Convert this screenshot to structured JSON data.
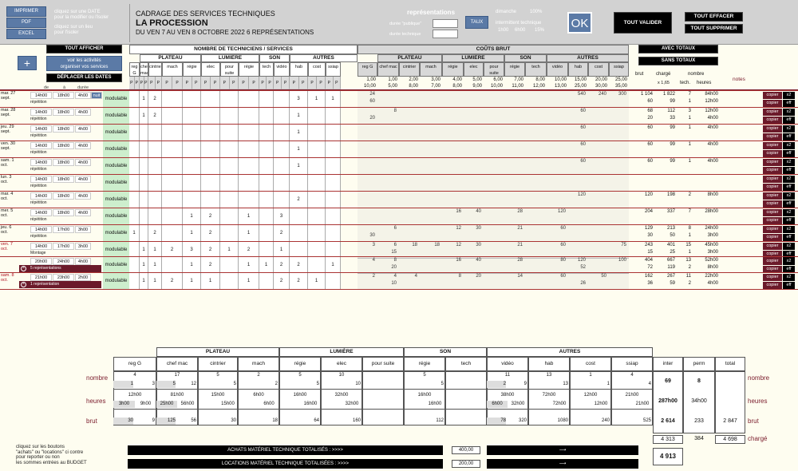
{
  "header": {
    "imprimer": "IMPRIMER",
    "pdf": "PDF",
    "excel": "EXCEL",
    "hint1a": "cliquez sur une DATE",
    "hint1b": "pour la modifier ou l'isoler",
    "hint2a": "cliquez sur un lieu",
    "hint2b": "pour l'isoler",
    "doc_title": "CADRAGE DES SERVICES TECHNIQUES",
    "show": "LA PROCESSION",
    "dates": "DU VEN 7 AU VEN 8 OCTOBRE 2022 6 REPRÉSENTATIONS",
    "representations": "représentations",
    "duree_public": "durée \"publique\"",
    "duree_technique": "durée technique",
    "taux": "TAUX",
    "dimanche": "dimanche",
    "dimanche_pct": "100%",
    "intermittent": "intermittent technique",
    "int1": "1h00",
    "int2": "6h00",
    "int3": "15%",
    "ok": "OK",
    "tout_valider": "TOUT VALIDER",
    "tout_effacer": "TOUT EFFACER",
    "tout_supprimer": "TOUT SUPPRIMER"
  },
  "toolbar": {
    "plus": "+",
    "tout_afficher": "TOUT AFFICHER",
    "voir1": "voir les activités",
    "voir2": "organiser vos services",
    "deplacer": "DÉPLACER LES DATES",
    "de": "de",
    "a": "à",
    "duree": "durée"
  },
  "sections": {
    "nombre": "NOMBRE DE TECHNICIENS / SERVICES",
    "couts": "COÛTS BRUT",
    "avec_totaux": "AVEC TOTAUX",
    "sans_totaux": "SANS TOTAUX",
    "brut": "brut",
    "charge": "chargé",
    "x165": "x 1,65",
    "nombre_tech": "nombre",
    "tech": "tech.",
    "heures": "heures",
    "notes": "notes"
  },
  "groups": {
    "plateau": "PLATEAU",
    "lumiere": "LUMIÈRE",
    "son": "SON",
    "autres": "AUTRES"
  },
  "cols": [
    "reg G",
    "chef mac",
    "cintrier",
    "mach",
    "régie",
    "elec",
    "pour suite",
    "régie",
    "tech",
    "vidéo",
    "hab",
    "cost",
    "ssiap"
  ],
  "rates": [
    [
      "1,00",
      "10,00"
    ],
    [
      "1,00",
      "5,00"
    ],
    [
      "2,00",
      "8,00"
    ],
    [
      "3,00",
      "7,00"
    ],
    [
      "4,00",
      "8,00"
    ],
    [
      "5,00",
      "9,00"
    ],
    [
      "6,00",
      "10,00"
    ],
    [
      "7,00",
      "11,00"
    ],
    [
      "8,00",
      "12,00"
    ],
    [
      "10,00",
      "13,00"
    ],
    [
      "15,00",
      "25,00"
    ],
    [
      "20,00",
      "30,00"
    ],
    [
      "25,00",
      "35,00"
    ]
  ],
  "rows": [
    {
      "d": "mar. 27",
      "m": "sept.",
      "t1": "14h00",
      "t2": "18h00",
      "t3": "4h00",
      "tag": "nuit",
      "sub": "répétition",
      "mod": "modulable",
      "counts": [
        "",
        "1",
        "2",
        "",
        "",
        "",
        "",
        "",
        "",
        "",
        "3",
        "1",
        "1"
      ],
      "c1": [
        "24",
        "",
        "",
        "",
        "",
        "",
        "",
        "",
        "",
        "",
        "540",
        "240",
        "300"
      ],
      "c2": [
        "60"
      ],
      "b": "1 104",
      "ch": "1 822",
      "n": "7",
      "h": "84h00",
      "b2": "60",
      "ch2": "99",
      "n2": "1",
      "h2": "12h00"
    },
    {
      "d": "mar. 28",
      "m": "sept.",
      "t1": "14h00",
      "t2": "18h00",
      "t3": "4h00",
      "sub": "répétition",
      "mod": "modulable",
      "counts": [
        "",
        "1",
        "2",
        "",
        "",
        "",
        "",
        "",
        "",
        "",
        "1",
        "",
        ""
      ],
      "c1": [
        "",
        "8",
        "",
        "",
        "",
        "",
        "",
        "",
        "",
        "",
        "60",
        "",
        ""
      ],
      "c2": [
        "20"
      ],
      "b": "68",
      "ch": "112",
      "n": "3",
      "h": "12h00",
      "b2": "20",
      "ch2": "33",
      "n2": "1",
      "h2": "4h00"
    },
    {
      "d": "jeu. 29",
      "m": "sept.",
      "t1": "14h00",
      "t2": "18h00",
      "t3": "4h00",
      "sub": "répétition",
      "mod": "modulable",
      "counts": [
        "",
        "",
        "",
        "",
        "",
        "",
        "",
        "",
        "",
        "",
        "1",
        "",
        ""
      ],
      "c1": [
        "",
        "",
        "",
        "",
        "",
        "",
        "",
        "",
        "",
        "",
        "60",
        "",
        ""
      ],
      "c2": [
        ""
      ],
      "b": "60",
      "ch": "99",
      "n": "1",
      "h": "4h00",
      "b2": "",
      "ch2": "",
      "n2": "",
      "h2": ""
    },
    {
      "d": "ven. 30",
      "m": "sept.",
      "t1": "14h00",
      "t2": "18h00",
      "t3": "4h00",
      "sub": "répétition",
      "mod": "modulable",
      "counts": [
        "",
        "",
        "",
        "",
        "",
        "",
        "",
        "",
        "",
        "",
        "1",
        "",
        ""
      ],
      "c1": [
        "",
        "",
        "",
        "",
        "",
        "",
        "",
        "",
        "",
        "",
        "60",
        "",
        ""
      ],
      "c2": [
        ""
      ],
      "b": "60",
      "ch": "99",
      "n": "1",
      "h": "4h00",
      "b2": "",
      "ch2": "",
      "n2": "",
      "h2": ""
    },
    {
      "d": "sam. 1",
      "m": "oct.",
      "t1": "14h00",
      "t2": "18h00",
      "t3": "4h00",
      "sub": "répétition",
      "mod": "modulable",
      "counts": [
        "",
        "",
        "",
        "",
        "",
        "",
        "",
        "",
        "",
        "",
        "1",
        "",
        ""
      ],
      "c1": [
        "",
        "",
        "",
        "",
        "",
        "",
        "",
        "",
        "",
        "",
        "60",
        "",
        ""
      ],
      "c2": [
        ""
      ],
      "b": "60",
      "ch": "99",
      "n": "1",
      "h": "4h00",
      "b2": "",
      "ch2": "",
      "n2": "",
      "h2": ""
    },
    {
      "d": "lun. 3",
      "m": "oct.",
      "t1": "14h00",
      "t2": "18h00",
      "t3": "4h00",
      "sub": "répétition",
      "mod": "modulable",
      "counts": [
        "",
        "",
        "",
        "",
        "",
        "",
        "",
        "",
        "",
        "",
        "",
        "",
        ""
      ],
      "c1": [
        "",
        "",
        "",
        "",
        "",
        "",
        "",
        "",
        "",
        "",
        "",
        "",
        ""
      ],
      "c2": [
        ""
      ],
      "b": "",
      "ch": "",
      "n": "",
      "h": "",
      "b2": "",
      "ch2": "",
      "n2": "",
      "h2": ""
    },
    {
      "d": "mar. 4",
      "m": "oct.",
      "t1": "14h00",
      "t2": "18h00",
      "t3": "4h00",
      "sub": "répétition",
      "mod": "modulable",
      "counts": [
        "",
        "",
        "",
        "",
        "",
        "",
        "",
        "",
        "",
        "",
        "2",
        "",
        ""
      ],
      "c1": [
        "",
        "",
        "",
        "",
        "",
        "",
        "",
        "",
        "",
        "",
        "120",
        "",
        ""
      ],
      "c2": [
        ""
      ],
      "b": "120",
      "ch": "198",
      "n": "2",
      "h": "8h00",
      "b2": "",
      "ch2": "",
      "n2": "",
      "h2": ""
    },
    {
      "d": "mer. 5",
      "m": "oct.",
      "t1": "14h00",
      "t2": "18h00",
      "t3": "4h00",
      "sub": "répétition",
      "mod": "modulable",
      "counts": [
        "",
        "",
        "",
        "",
        "1",
        "2",
        "",
        "1",
        "",
        "3",
        "",
        "",
        ""
      ],
      "c1": [
        "",
        "",
        "",
        "",
        "16",
        "40",
        "",
        "28",
        "",
        "120",
        "",
        "",
        ""
      ],
      "c2": [
        ""
      ],
      "b": "204",
      "ch": "337",
      "n": "7",
      "h": "28h00",
      "b2": "",
      "ch2": "",
      "n2": "",
      "h2": ""
    },
    {
      "d": "jeu. 6",
      "m": "oct.",
      "t1": "14h00",
      "t2": "17h00",
      "t3": "3h00",
      "sub": "répétition",
      "mod": "modulable",
      "counts": [
        "1",
        "",
        "2",
        "",
        "1",
        "2",
        "",
        "1",
        "",
        "2",
        "",
        "",
        ""
      ],
      "c1": [
        "",
        "6",
        "",
        "",
        "12",
        "30",
        "",
        "21",
        "",
        "60",
        "",
        "",
        ""
      ],
      "c2": [
        "30"
      ],
      "b": "129",
      "ch": "213",
      "n": "8",
      "h": "24h00",
      "b2": "30",
      "ch2": "50",
      "n2": "1",
      "h2": "3h00"
    },
    {
      "d": "ven. 7",
      "m": "oct.",
      "red": true,
      "t1": "14h00",
      "t2": "17h00",
      "t3": "3h00",
      "sub": "Montage",
      "mod": "modulable",
      "counts": [
        "",
        "1",
        "1",
        "2",
        "3",
        "2",
        "1",
        "2",
        "",
        "1",
        "",
        "",
        ""
      ],
      "c1": [
        "3",
        "6",
        "18",
        "18",
        "12",
        "30",
        "",
        "21",
        "",
        "60",
        "",
        "",
        "75"
      ],
      "c2": [
        "",
        "15"
      ],
      "b": "243",
      "ch": "401",
      "n": "15",
      "h": "45h00",
      "b2": "15",
      "ch2": "25",
      "n2": "1",
      "h2": "3h00"
    },
    {
      "d": "",
      "m": "",
      "t1": "20h00",
      "t2": "24h00",
      "t3": "4h00",
      "sub": "5 représentations",
      "subdark": true,
      "mod": "modulable",
      "counts": [
        "",
        "1",
        "1",
        "",
        "1",
        "2",
        "",
        "1",
        "1",
        "2",
        "2",
        "",
        "1"
      ],
      "c1": [
        "4",
        "8",
        "",
        "",
        "16",
        "40",
        "",
        "28",
        "",
        "80",
        "120",
        "",
        "100"
      ],
      "c2": [
        "",
        "20",
        "",
        "",
        "",
        "",
        "",
        "",
        "",
        "",
        "52"
      ],
      "b": "404",
      "ch": "667",
      "n": "13",
      "h": "52h00",
      "b2": "72",
      "ch2": "119",
      "n2": "2",
      "h2": "8h00"
    },
    {
      "d": "sam. 8",
      "m": "oct.",
      "red": true,
      "t1": "21h00",
      "t2": "23h00",
      "t3": "2h00",
      "sub": "1 représentation",
      "subdark": true,
      "mod": "modulable",
      "counts": [
        "",
        "1",
        "1",
        "2",
        "1",
        "1",
        "",
        "1",
        "",
        "2",
        "2",
        "1",
        ""
      ],
      "c1": [
        "2",
        "4",
        "4",
        "",
        "8",
        "20",
        "",
        "14",
        "",
        "60",
        "",
        "50",
        ""
      ],
      "c2": [
        "",
        "10",
        "",
        "",
        "",
        "",
        "",
        "",
        "",
        "",
        "26"
      ],
      "b": "162",
      "ch": "267",
      "n": "11",
      "h": "22h00",
      "b2": "36",
      "ch2": "59",
      "n2": "2",
      "h2": "4h00"
    }
  ],
  "rowbtns": {
    "copier": "copier",
    "x2": "x2",
    "eff": "eff"
  },
  "summary": {
    "nombre": "nombre",
    "heures": "heures",
    "brut": "brut",
    "charge": "chargé",
    "groups": {
      "plateau": "PLATEAU",
      "lumiere": "LUMIÈRE",
      "son": "SON",
      "autres": "AUTRES"
    },
    "cols": [
      "reg G",
      "chef mac",
      "cintrier",
      "mach",
      "régie",
      "elec",
      "pour suite",
      "régie",
      "tech",
      "vidéo",
      "hab",
      "cost",
      "ssiap",
      "inter",
      "perm",
      "total"
    ],
    "nb_top": [
      "4",
      "17",
      "5",
      "2",
      "5",
      "10",
      "",
      "5",
      "",
      "11",
      "13",
      "1",
      "4"
    ],
    "nb_sub": [
      [
        "1",
        "3"
      ],
      [
        "5",
        "12"
      ],
      [
        "",
        "5"
      ],
      [
        "",
        "2"
      ],
      [
        "",
        "5"
      ],
      [
        "",
        "10"
      ],
      [
        "",
        ""
      ],
      [
        "",
        "5"
      ],
      [
        "",
        ""
      ],
      [
        "2",
        "9"
      ],
      [
        "",
        "13"
      ],
      [
        "",
        "1"
      ],
      [
        "",
        "4"
      ]
    ],
    "inter_nb": "69",
    "perm_nb": "8",
    "hr_top": [
      "12h00",
      "81h00",
      "15h00",
      "6h00",
      "16h00",
      "32h00",
      "",
      "16h00",
      "",
      "38h00",
      "72h00",
      "12h00",
      "21h00"
    ],
    "hr_sub": [
      [
        "3h00",
        "9h00"
      ],
      [
        "25h00",
        "56h00"
      ],
      [
        "",
        "15h00"
      ],
      [
        "",
        "6h00"
      ],
      [
        "",
        "16h00"
      ],
      [
        "",
        "32h00"
      ],
      [
        "",
        ""
      ],
      [
        "",
        "16h00"
      ],
      [
        "",
        ""
      ],
      [
        "6h00",
        "32h00"
      ],
      [
        "",
        "72h00"
      ],
      [
        "",
        "12h00"
      ],
      [
        "",
        "21h00"
      ]
    ],
    "inter_hr": "287h00",
    "perm_hr": "34h00",
    "br": [
      [
        "30",
        "9"
      ],
      [
        "125",
        "56"
      ],
      [
        "",
        "30"
      ],
      [
        "",
        "18"
      ],
      [
        "",
        "64"
      ],
      [
        "",
        "160"
      ],
      [
        "",
        ""
      ],
      [
        "",
        "112"
      ],
      [
        "",
        ""
      ],
      [
        "78",
        "320"
      ],
      [
        "",
        "1080"
      ],
      [
        "",
        "240"
      ],
      [
        "",
        "525"
      ]
    ],
    "inter_br": "2 614",
    "perm_br": "233",
    "total_br": "2 847",
    "inter_ch": "4 313",
    "perm_ch": "384",
    "total_ch": "4 698",
    "grand": "4 913",
    "hint1": "cliquez sur les boutons",
    "hint2": "\"achats\" ou \"locations\" ci contre",
    "hint3": "pour reporter ou non",
    "hint4": "les sommes entrées au BUDGET",
    "achats": "ACHATS MATÉRIEL TECHNIQUE TOTALISÉS :     >>>>",
    "achats_val": "400,00",
    "locations": "LOCATIONS MATÉRIEL TECHNIQUE TOTALISÉES :     >>>>",
    "locations_val": "200,00"
  }
}
